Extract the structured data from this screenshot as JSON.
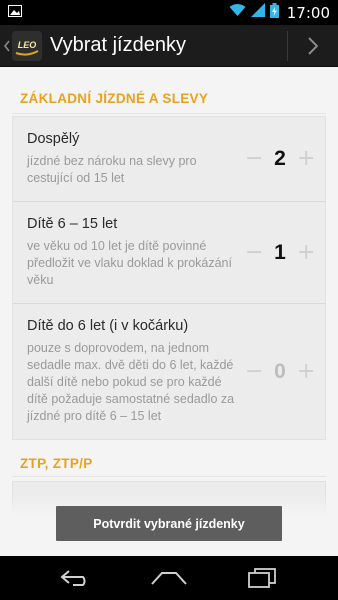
{
  "status_bar": {
    "time": "17:00",
    "icons": [
      "photo-notification-icon",
      "wifi-icon",
      "signal-icon",
      "battery-charging-icon"
    ]
  },
  "action_bar": {
    "title": "Vybrat jízdenky",
    "logo_text": "LEO",
    "icons": [
      "up-chevron-icon",
      "next-chevron-icon"
    ]
  },
  "sections": [
    {
      "header": "ZÁKLADNÍ JÍZDNÉ A SLEVY",
      "items": [
        {
          "title": "Dospělý",
          "description": "jízdné bez nároku na slevy pro cestující od 15 let",
          "count": "2",
          "minus": "−",
          "plus": "+"
        },
        {
          "title": "Dítě 6 – 15 let",
          "description": "ve věku od 10 let je dítě povinné předložit ve vlaku doklad k prokázání věku",
          "count": "1",
          "minus": "−",
          "plus": "+"
        },
        {
          "title": "Dítě do 6 let (i v kočárku)",
          "description": "pouze s doprovodem, na jednom sedadle max. dvě děti do 6 let, každé další dítě nebo pokud se pro každé dítě požaduje samostatné sedadlo za jízdné pro dítě 6 – 15 let",
          "count": "0",
          "minus": "−",
          "plus": "+"
        }
      ]
    },
    {
      "header": "ZTP, ZTP/P",
      "items": []
    }
  ],
  "confirm_button": {
    "label": "Potvrdit vybrané jízdenky"
  },
  "nav_bar": {
    "icons": [
      "back-icon",
      "home-icon",
      "recent-apps-icon"
    ]
  },
  "colors": {
    "accent": "#e8a21b",
    "action_bar": "#1c1c1c",
    "background": "#f4f4f4",
    "button": "#5e5e5e"
  }
}
